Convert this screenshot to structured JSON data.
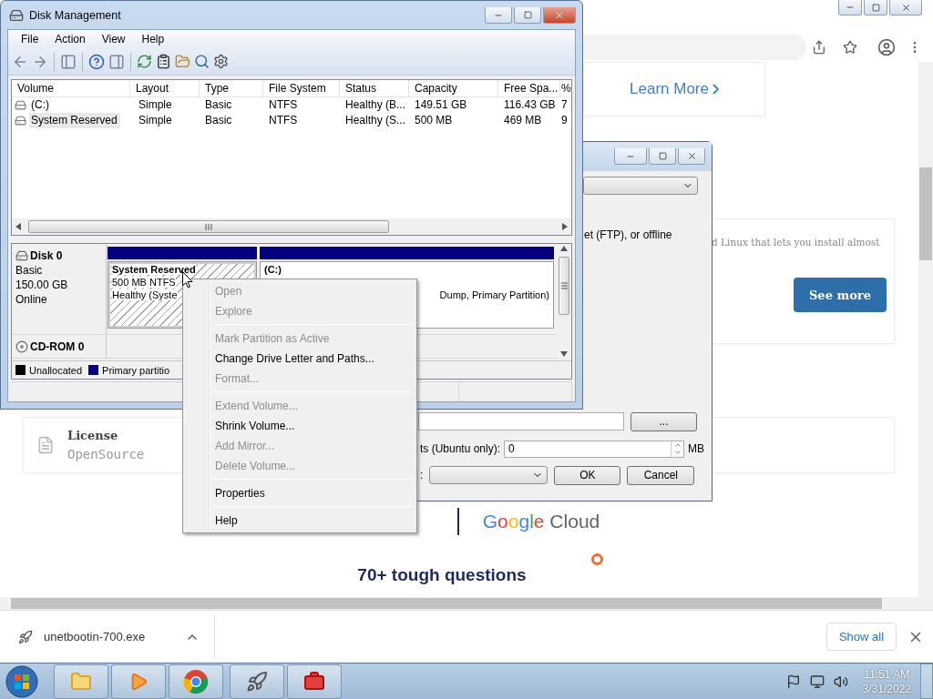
{
  "browser": {
    "learn_more": "Learn More",
    "card_text": "d Linux that lets you install almost",
    "see_more": "See more",
    "license_title": "License",
    "license_value": "OpenSource",
    "ad_brand": "Google Cloud",
    "ad_headline": "70+ tough questions",
    "download_file": "unetbootin-700.exe",
    "show_all": "Show all"
  },
  "unetbootin": {
    "description": "et (FTP), or offline",
    "browse": "...",
    "size_label": "ts (Ubuntu only):",
    "size_value": "0",
    "size_unit": "MB",
    "type_label": ":",
    "ok": "OK",
    "cancel": "Cancel"
  },
  "disk_management": {
    "title": "Disk Management",
    "menu": [
      "File",
      "Action",
      "View",
      "Help"
    ],
    "columns": [
      "Volume",
      "Layout",
      "Type",
      "File System",
      "Status",
      "Capacity",
      "Free Spa...",
      "%"
    ],
    "volumes": [
      {
        "cells": [
          "(C:)",
          "Simple",
          "Basic",
          "NTFS",
          "Healthy (B...",
          "149.51 GB",
          "116.43 GB",
          "7"
        ],
        "selected": false
      },
      {
        "cells": [
          "System Reserved",
          "Simple",
          "Basic",
          "NTFS",
          "Healthy (S...",
          "500 MB",
          "469 MB",
          "9"
        ],
        "selected": true
      }
    ],
    "disks": [
      {
        "kind": "disk",
        "name": "Disk 0",
        "info": [
          "Basic",
          "150.00 GB",
          "Online"
        ],
        "partitions": [
          {
            "name": "System Reserved",
            "lines": [
              "500 MB NTFS",
              "Healthy (Syste"
            ],
            "selected": true
          },
          {
            "name": "(C:)",
            "lines": [
              "Dump, Primary Partition)"
            ],
            "selected": false
          }
        ]
      },
      {
        "kind": "cdrom",
        "name": "CD-ROM 0"
      }
    ],
    "legend": [
      {
        "label": "Unallocated",
        "color": "#000000"
      },
      {
        "label": "Primary partitio",
        "color": "#000080"
      }
    ]
  },
  "context_menu": [
    {
      "kind": "item",
      "label": "Open",
      "disabled": true
    },
    {
      "kind": "item",
      "label": "Explore",
      "disabled": true
    },
    {
      "kind": "separator"
    },
    {
      "kind": "item",
      "label": "Mark Partition as Active",
      "disabled": true
    },
    {
      "kind": "item",
      "label": "Change Drive Letter and Paths...",
      "disabled": false
    },
    {
      "kind": "item",
      "label": "Format...",
      "disabled": true
    },
    {
      "kind": "separator"
    },
    {
      "kind": "item",
      "label": "Extend Volume...",
      "disabled": true
    },
    {
      "kind": "item",
      "label": "Shrink Volume...",
      "disabled": false
    },
    {
      "kind": "item",
      "label": "Add Mirror...",
      "disabled": true
    },
    {
      "kind": "item",
      "label": "Delete Volume...",
      "disabled": true
    },
    {
      "kind": "separator"
    },
    {
      "kind": "item",
      "label": "Properties",
      "disabled": false
    },
    {
      "kind": "separator"
    },
    {
      "kind": "item",
      "label": "Help",
      "disabled": false
    }
  ],
  "taskbar": {
    "time": "11:51 AM",
    "date": "3/31/2022"
  }
}
